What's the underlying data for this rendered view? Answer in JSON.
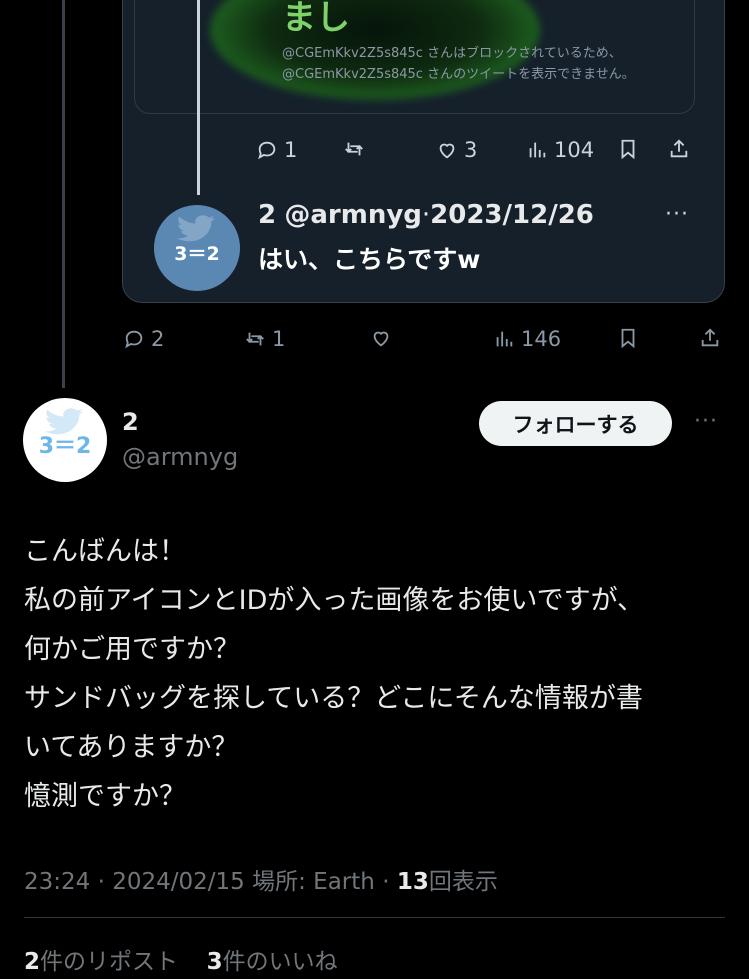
{
  "quote": {
    "hidden_heading": "まし",
    "notice_text": "@CGEmKkv2Z5s845c さんはブロックされているため、@CGEmKkv2Z5s845c さんのツイートを表示できません。",
    "actions": {
      "reply_count": "1",
      "retweet_count": "",
      "like_count": "3",
      "view_count": "104"
    },
    "reply": {
      "avatar_text": "3＝2",
      "name": "2",
      "handle": "@armnyg",
      "separator": "·",
      "date": "2023/12/26",
      "more": "···",
      "text": "はい、こちらですw"
    }
  },
  "parent_actions": {
    "reply_count": "2",
    "retweet_count": "1",
    "like_count": "",
    "view_count": "146"
  },
  "tweet": {
    "avatar_text": "3＝2",
    "name": "2",
    "handle": "@armnyg",
    "follow_label": "フォローする",
    "more": "···",
    "lines": [
      "こんばんは！",
      "私の前アイコンとIDが入った画像をお使いですが、",
      "何かご用ですか？",
      "サンドバッグを探している？どこにそんな情報が書",
      "いてありますか？",
      "憶測ですか？"
    ],
    "time": "23:24",
    "date": "2024/02/15",
    "location_label": "場所: Earth",
    "views": "13",
    "views_label": "回表示",
    "sep": "·"
  },
  "engagement": {
    "reposts": "2",
    "reposts_label": "件のリポスト",
    "likes": "3",
    "likes_label": "件のいいね"
  },
  "colors": {
    "accent": "#1d9bf0",
    "muted": "#71767b",
    "card_bg": "#15202b",
    "blur_green": "#1d5c1f"
  },
  "icons": [
    "reply-icon",
    "retweet-icon",
    "heart-icon",
    "views-icon",
    "bookmark-icon",
    "share-icon",
    "bird-icon",
    "more-icon"
  ]
}
